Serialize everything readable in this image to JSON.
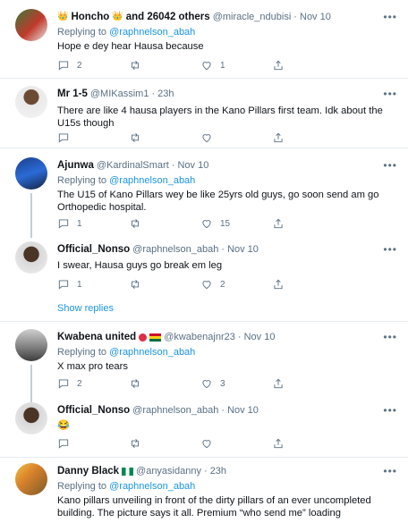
{
  "tweets": [
    {
      "name": "Honcho",
      "extra": "and 26042 others",
      "handle": "@miracle_ndubisi",
      "time": "· Nov 10",
      "reply_label": "Replying to",
      "reply_handle": "@raphnelson_abah",
      "text": "Hope e dey hear Hausa because",
      "replies": "2",
      "retweets": "",
      "likes": "1"
    },
    {
      "name": "Mr 1-5",
      "handle": "@MIKassim1",
      "time": "· 23h",
      "text": "There are like 4 hausa players in the Kano Pillars first team. Idk about the U15s though",
      "replies": "",
      "retweets": "",
      "likes": ""
    },
    {
      "name": "Ajunwa",
      "handle": "@KardinalSmart",
      "time": "· Nov 10",
      "reply_label": "Replying to",
      "reply_handle": "@raphnelson_abah",
      "text": "The U15 of Kano Pillars wey be like 25yrs old guys, go soon send am go Orthopedic hospital.",
      "replies": "1",
      "retweets": "",
      "likes": "15"
    },
    {
      "name": "Official_Nonso",
      "handle": "@raphnelson_abah",
      "time": "· Nov 10",
      "text": "I swear, Hausa guys go break em leg",
      "replies": "1",
      "retweets": "",
      "likes": "2"
    },
    {
      "name": "Kwabena united",
      "handle": "@kwabenajnr23",
      "time": "· Nov 10",
      "reply_label": "Replying to",
      "reply_handle": "@raphnelson_abah",
      "text": "X max pro tears",
      "replies": "2",
      "retweets": "",
      "likes": "3"
    },
    {
      "name": "Official_Nonso",
      "handle": "@raphnelson_abah",
      "time": "· Nov 10",
      "text": "😂",
      "replies": "",
      "retweets": "",
      "likes": ""
    },
    {
      "name": "Danny Black",
      "handle": "@anyasidanny",
      "time": "· 23h",
      "reply_label": "Replying to",
      "reply_handle": "@raphnelson_abah",
      "text": "Kano pillars unveiling in front of the dirty pillars of an ever uncompleted building. The picture says it all. Premium “who send me” loading"
    }
  ],
  "show_replies": "Show replies",
  "more_glyph": "•••",
  "colors": {
    "accent": "#1b95e0",
    "muted": "#5b7083",
    "border": "#e6ecf0"
  }
}
